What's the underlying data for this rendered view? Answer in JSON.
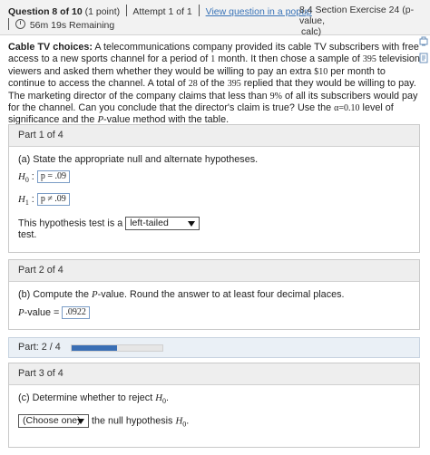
{
  "header": {
    "question_label": "Question 8 of 10",
    "points": "(1 point)",
    "attempt": "Attempt 1 of 1",
    "popup_link": "View question in a popup",
    "time_remaining": "56m 19s Remaining",
    "section_line1": "8.4 Section Exercise 24 (p-value,",
    "section_line2": "calc)"
  },
  "side_icons": [
    "print-icon",
    "notes-icon"
  ],
  "problem": {
    "title": "Cable TV choices:",
    "t1": " A telecommunications company provided its cable TV subscribers with free access to a new sports channel for a period of ",
    "n1": "1",
    "t2": " month. It then chose a sample of ",
    "n2": "395",
    "t3": " television viewers and asked them whether they would be willing to pay an extra ",
    "n3": "$10",
    "t4": " per month to continue to access the channel. A total of ",
    "n4": "28",
    "t5": " of the ",
    "n5": "395",
    "t6": " replied that they would be willing to pay. The marketing director of the company claims that less than ",
    "n6": "9%",
    "t7": " of all its subscribers would pay for the channel. Can you conclude that the director's claim is true? Use the ",
    "n7": "α=0.10",
    "t8": " level of significance and the ",
    "n8": "P",
    "t9": "-value method with the table."
  },
  "part1": {
    "heading": "Part 1 of 4",
    "instruction": "(a) State the appropriate null and alternate hypotheses.",
    "h0_label": "H",
    "h0_sub": "0",
    "h0_value": "p = .09",
    "h1_label": "H",
    "h1_sub": "1",
    "h1_value": "p ≠ .09",
    "test_prefix": "This hypothesis test is a",
    "test_select": "left-tailed",
    "test_suffix": "test."
  },
  "part2": {
    "heading": "Part 2 of 4",
    "instruction_a": "(b) Compute the ",
    "instruction_p": "P",
    "instruction_b": "-value. Round the answer to at least four decimal places.",
    "pvalue_label_p": "P",
    "pvalue_label": "-value",
    "pvalue_value": ".0922"
  },
  "progress": {
    "label": "Part: 2 / 4",
    "fraction": 0.5
  },
  "part3": {
    "heading": "Part 3 of 4",
    "instruction_a": "(c) Determine whether to reject ",
    "instruction_h": "H",
    "instruction_sub": "0",
    "instruction_end": ".",
    "select_label": "(Choose one)",
    "suffix_a": "the null hypothesis ",
    "suffix_h": "H",
    "suffix_sub": "0",
    "suffix_end": "."
  }
}
